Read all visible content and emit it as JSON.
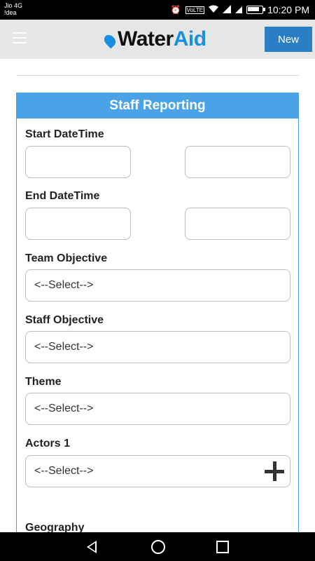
{
  "statusbar": {
    "carrier_line1": "Jio 4G",
    "carrier_line2": "!dea",
    "time": "10:20 PM",
    "icons": [
      "alarm-icon",
      "volte-icon",
      "wifi-icon",
      "signal-icon",
      "battery-icon"
    ]
  },
  "header": {
    "logo_part1": "Water",
    "logo_part2": "Aid",
    "new_label": "New",
    "menu_icon": "hamburger-icon"
  },
  "form": {
    "title": "Staff Reporting",
    "start_label": "Start DateTime",
    "end_label": "End DateTime",
    "team_objective_label": "Team Objective",
    "team_objective_value": "<--Select-->",
    "staff_objective_label": "Staff Objective",
    "staff_objective_value": "<--Select-->",
    "theme_label": "Theme",
    "theme_value": "<--Select-->",
    "actors_label": "Actors 1",
    "actors_value": "<--Select-->",
    "geography_label": "Geography"
  },
  "colors": {
    "accent": "#4aa3e6",
    "button": "#2a7fc4",
    "logo_blue": "#1a8fe0"
  }
}
